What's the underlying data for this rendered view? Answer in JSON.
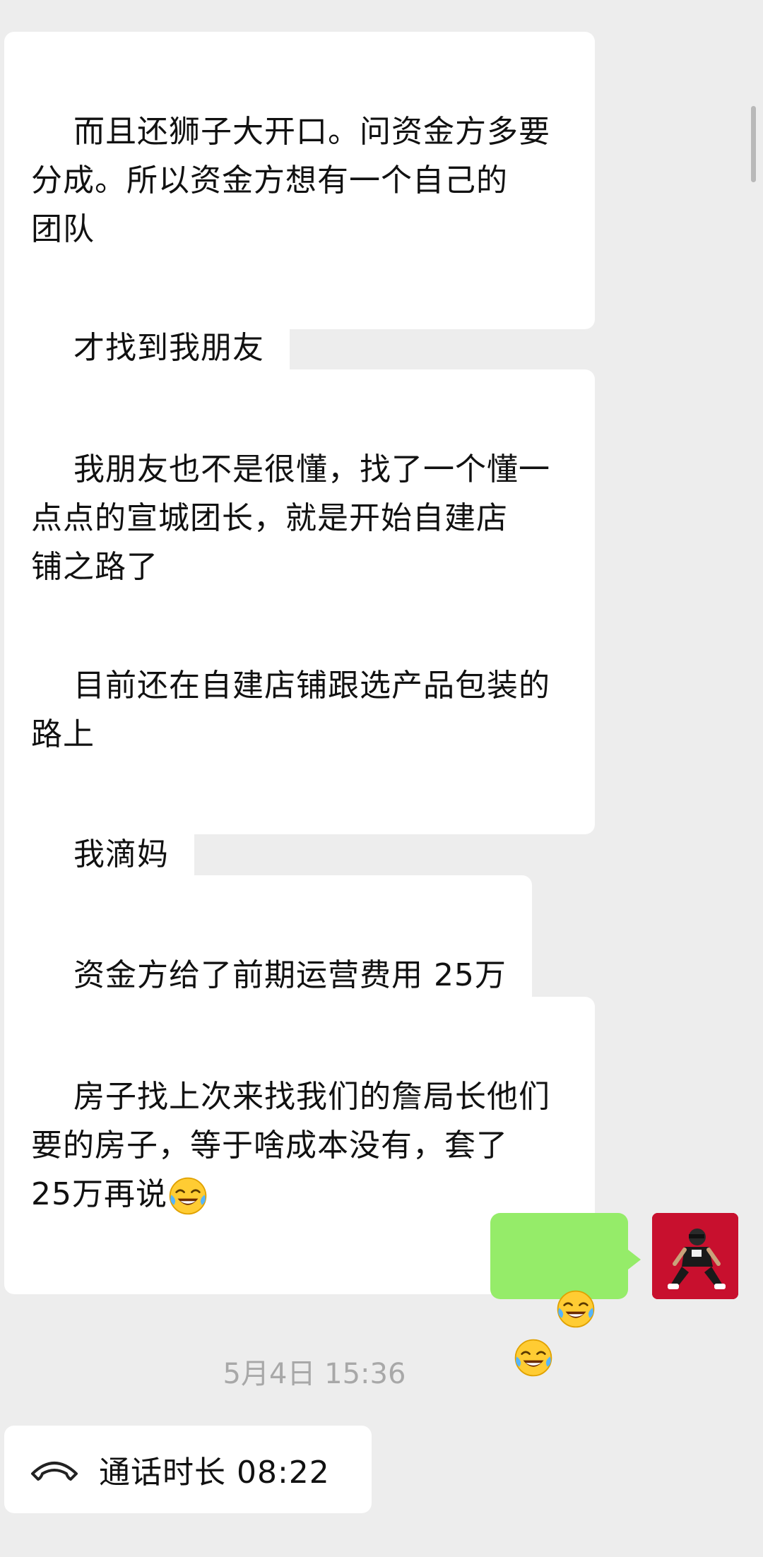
{
  "messages": [
    {
      "text": "而且还狮子大开口。问资金方多要\n分成。所以资金方想有一个自己的\n团队"
    },
    {
      "text": "才找到我朋友"
    },
    {
      "text": "我朋友也不是很懂，找了一个懂一\n点点的宣城团长，就是开始自建店\n铺之路了"
    },
    {
      "text": "目前还在自建店铺跟选产品包装的\n路上"
    },
    {
      "text": "我滴妈"
    },
    {
      "text": "资金方给了前期运营费用 25万"
    },
    {
      "text": "房子找上次来找我们的詹局长他们\n要的房子，等于啥成本没有，套了\n25万再说",
      "emoji": "crying-laughing-emoji"
    }
  ],
  "self_message": {
    "emojis": [
      "crying-laughing-emoji",
      "crying-laughing-emoji"
    ]
  },
  "timestamp": "5月4日 15:36",
  "call": {
    "label": "通话时长 08:22",
    "icon": "phone-hangup-icon"
  },
  "colors": {
    "self_bubble": "#95ec69",
    "other_bubble": "#ffffff",
    "background": "#ededed",
    "avatar_bg": "#c8102e"
  }
}
